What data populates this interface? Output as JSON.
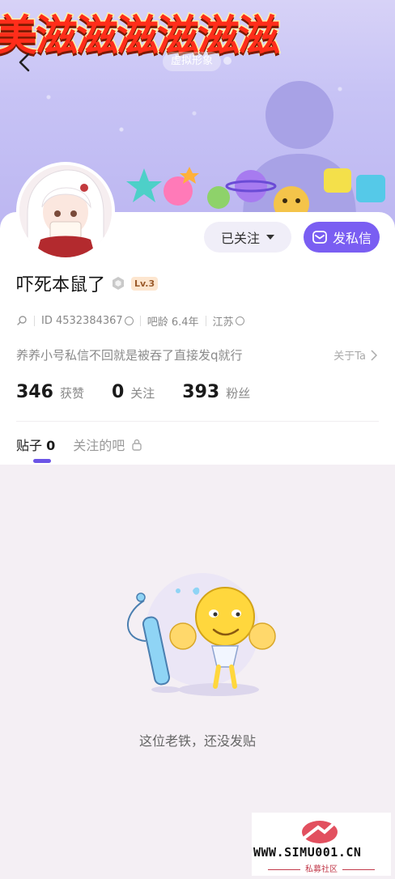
{
  "banner": {
    "headline": "美滋滋滋滋滋滋",
    "virtual_avatar_label": "虚拟形象"
  },
  "profile": {
    "name": "吓死本鼠了",
    "level": "Lv.3",
    "id_text": "ID 4532384367",
    "age_text": "吧龄 6.4年",
    "location": "江苏",
    "bio": "养养小号私信不回就是被吞了直接发q就行",
    "about_label": "关于Ta"
  },
  "actions": {
    "follow_label": "已关注",
    "message_label": "发私信"
  },
  "stats": [
    {
      "value": "346",
      "label": "获赞"
    },
    {
      "value": "0",
      "label": "关注"
    },
    {
      "value": "393",
      "label": "粉丝"
    }
  ],
  "tabs": {
    "posts_label": "贴子",
    "posts_count": "0",
    "followed_bars_label": "关注的吧"
  },
  "empty_state": {
    "message": "这位老铁，还没发贴"
  },
  "watermark": {
    "site": "WWW.SIMU001.CN",
    "subtitle": "私募社区"
  },
  "colors": {
    "accent": "#7a5ef2",
    "tab_indicator": "#6c55e6",
    "banner": "#c7c3f5",
    "page_bg": "#f4eff4"
  }
}
